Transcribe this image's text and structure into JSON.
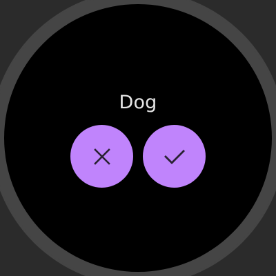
{
  "dialog": {
    "title": "Dog",
    "cancel_icon": "close-icon",
    "confirm_icon": "check-icon"
  },
  "colors": {
    "background": "#2b2b2b",
    "bezel": "#454545",
    "face": "#000000",
    "button_fill": "#c084fc",
    "icon": "#2a2233",
    "title_text": "#e6e6e6"
  }
}
